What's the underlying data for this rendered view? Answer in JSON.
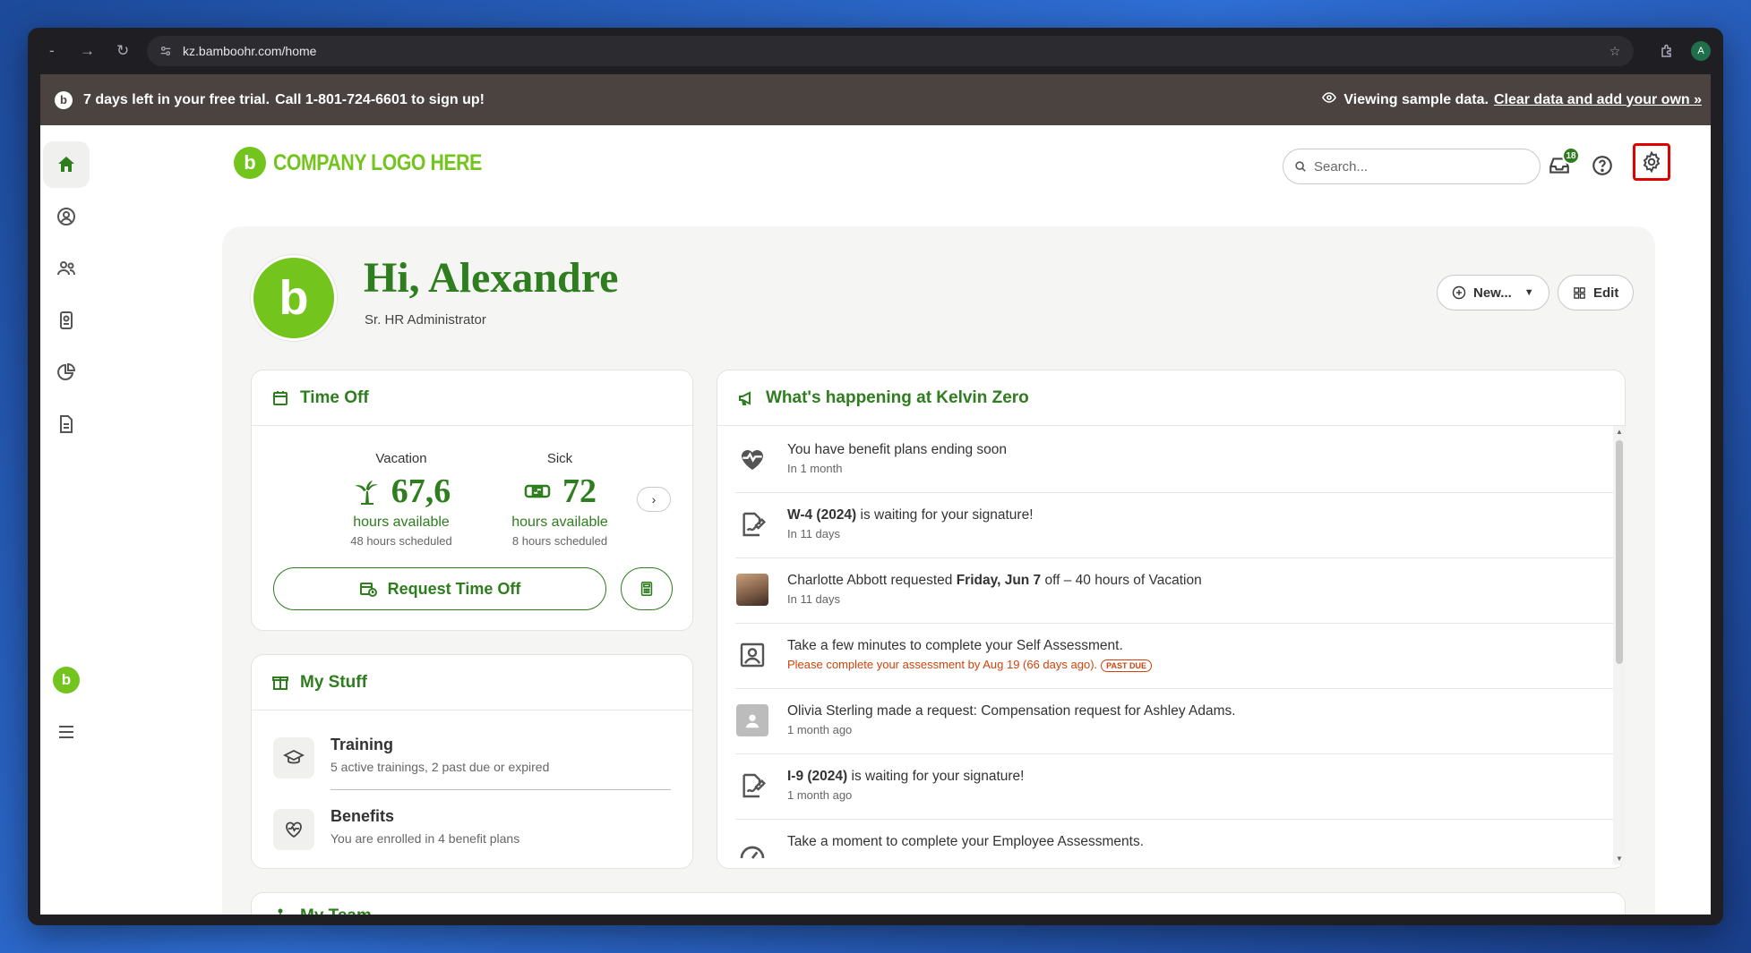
{
  "browser": {
    "url": "kz.bamboohr.com/home"
  },
  "trial": {
    "days_text": "7 days left in your free trial.",
    "call_text": "Call 1-801-724-6601 to sign up!",
    "viewing_text": "Viewing sample data.",
    "clear_link": "Clear data and add your own »"
  },
  "header": {
    "logo_text": "COMPANY LOGO HERE",
    "search_placeholder": "Search...",
    "inbox_count": "18"
  },
  "user": {
    "greeting": "Hi, Alexandre",
    "role": "Sr. HR Administrator"
  },
  "actions": {
    "new_label": "New...",
    "edit_label": "Edit"
  },
  "time_off": {
    "title": "Time Off",
    "vacation": {
      "label": "Vacation",
      "value": "67,6",
      "available": "hours available",
      "scheduled": "48 hours scheduled"
    },
    "sick": {
      "label": "Sick",
      "value": "72",
      "available": "hours available",
      "scheduled": "8 hours scheduled"
    },
    "request_label": "Request Time Off"
  },
  "my_stuff": {
    "title": "My Stuff",
    "items": [
      {
        "title": "Training",
        "sub": "5 active trainings, 2 past due or expired"
      },
      {
        "title": "Benefits",
        "sub": "You are enrolled in 4 benefit plans"
      }
    ]
  },
  "happening": {
    "title": "What's happening at Kelvin Zero",
    "items": [
      {
        "pre": "You have benefit plans ending soon",
        "bold": "",
        "post": "",
        "sub": "In 1 month"
      },
      {
        "pre": "",
        "bold": "W-4 (2024)",
        "post": " is waiting for your signature!",
        "sub": "In 11 days"
      },
      {
        "pre": "Charlotte Abbott requested ",
        "bold": "Friday, Jun 7",
        "post": " off – 40 hours of Vacation",
        "sub": "In 11 days"
      },
      {
        "pre": "Take a few minutes to complete your Self Assessment.",
        "bold": "",
        "post": "",
        "sub": "Please complete your assessment by Aug 19 (66 days ago).",
        "badge": "PAST DUE"
      },
      {
        "pre": "Olivia Sterling made a request: Compensation request for Ashley Adams.",
        "bold": "",
        "post": "",
        "sub": "1 month ago"
      },
      {
        "pre": "",
        "bold": "I-9 (2024)",
        "post": " is waiting for your signature!",
        "sub": "1 month ago"
      },
      {
        "pre": "Take a moment to complete your Employee Assessments.",
        "bold": "",
        "post": "",
        "sub": ""
      }
    ]
  },
  "my_team": {
    "title": "My Team"
  }
}
